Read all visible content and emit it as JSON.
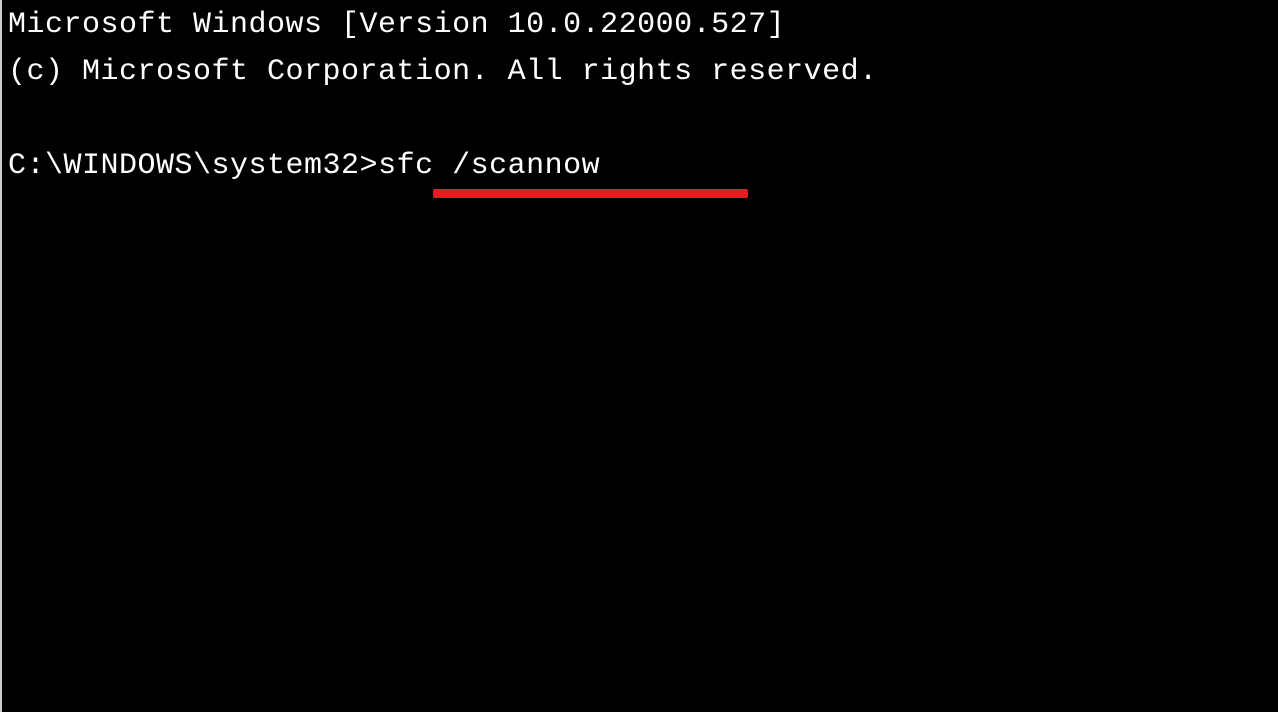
{
  "terminal": {
    "version_line": "Microsoft Windows [Version 10.0.22000.527]",
    "copyright_line": "(c) Microsoft Corporation. All rights reserved.",
    "prompt": "C:\\WINDOWS\\system32>",
    "command": "sfc /scannow"
  },
  "annotation": {
    "underline_color": "#e02020"
  }
}
